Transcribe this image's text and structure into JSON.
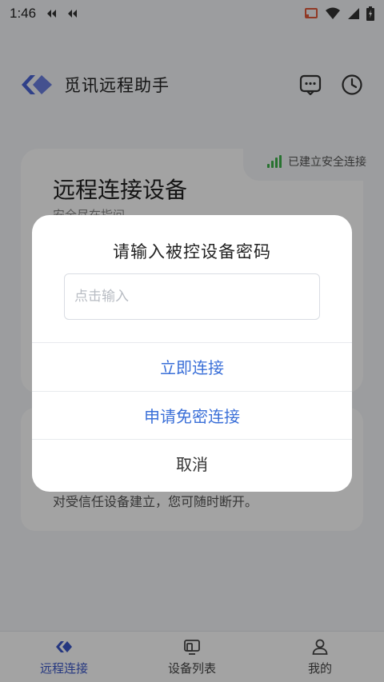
{
  "status_bar": {
    "time": "1:46"
  },
  "header": {
    "title": "觅讯远程助手"
  },
  "connect_card": {
    "title": "远程连接设备",
    "subtitle": "安全尽在指间",
    "secure_status": "已建立安全连接"
  },
  "info_card": {
    "text": "对受信任设备建立，您可随时断开。"
  },
  "dialog": {
    "title": "请输入被控设备密码",
    "input_placeholder": "点击输入",
    "input_value": "",
    "connect_label": "立即连接",
    "request_label": "申请免密连接",
    "cancel_label": "取消"
  },
  "bottom_nav": {
    "items": [
      {
        "label": "远程连接",
        "icon": "remote-connect-icon",
        "active": true
      },
      {
        "label": "设备列表",
        "icon": "device-list-icon",
        "active": false
      },
      {
        "label": "我的",
        "icon": "profile-icon",
        "active": false
      }
    ]
  },
  "colors": {
    "accent": "#3a6fd8",
    "nav_active": "#3a56c9",
    "signal": "#3fb24b",
    "overlay": "rgba(0,0,0,0.36)"
  }
}
